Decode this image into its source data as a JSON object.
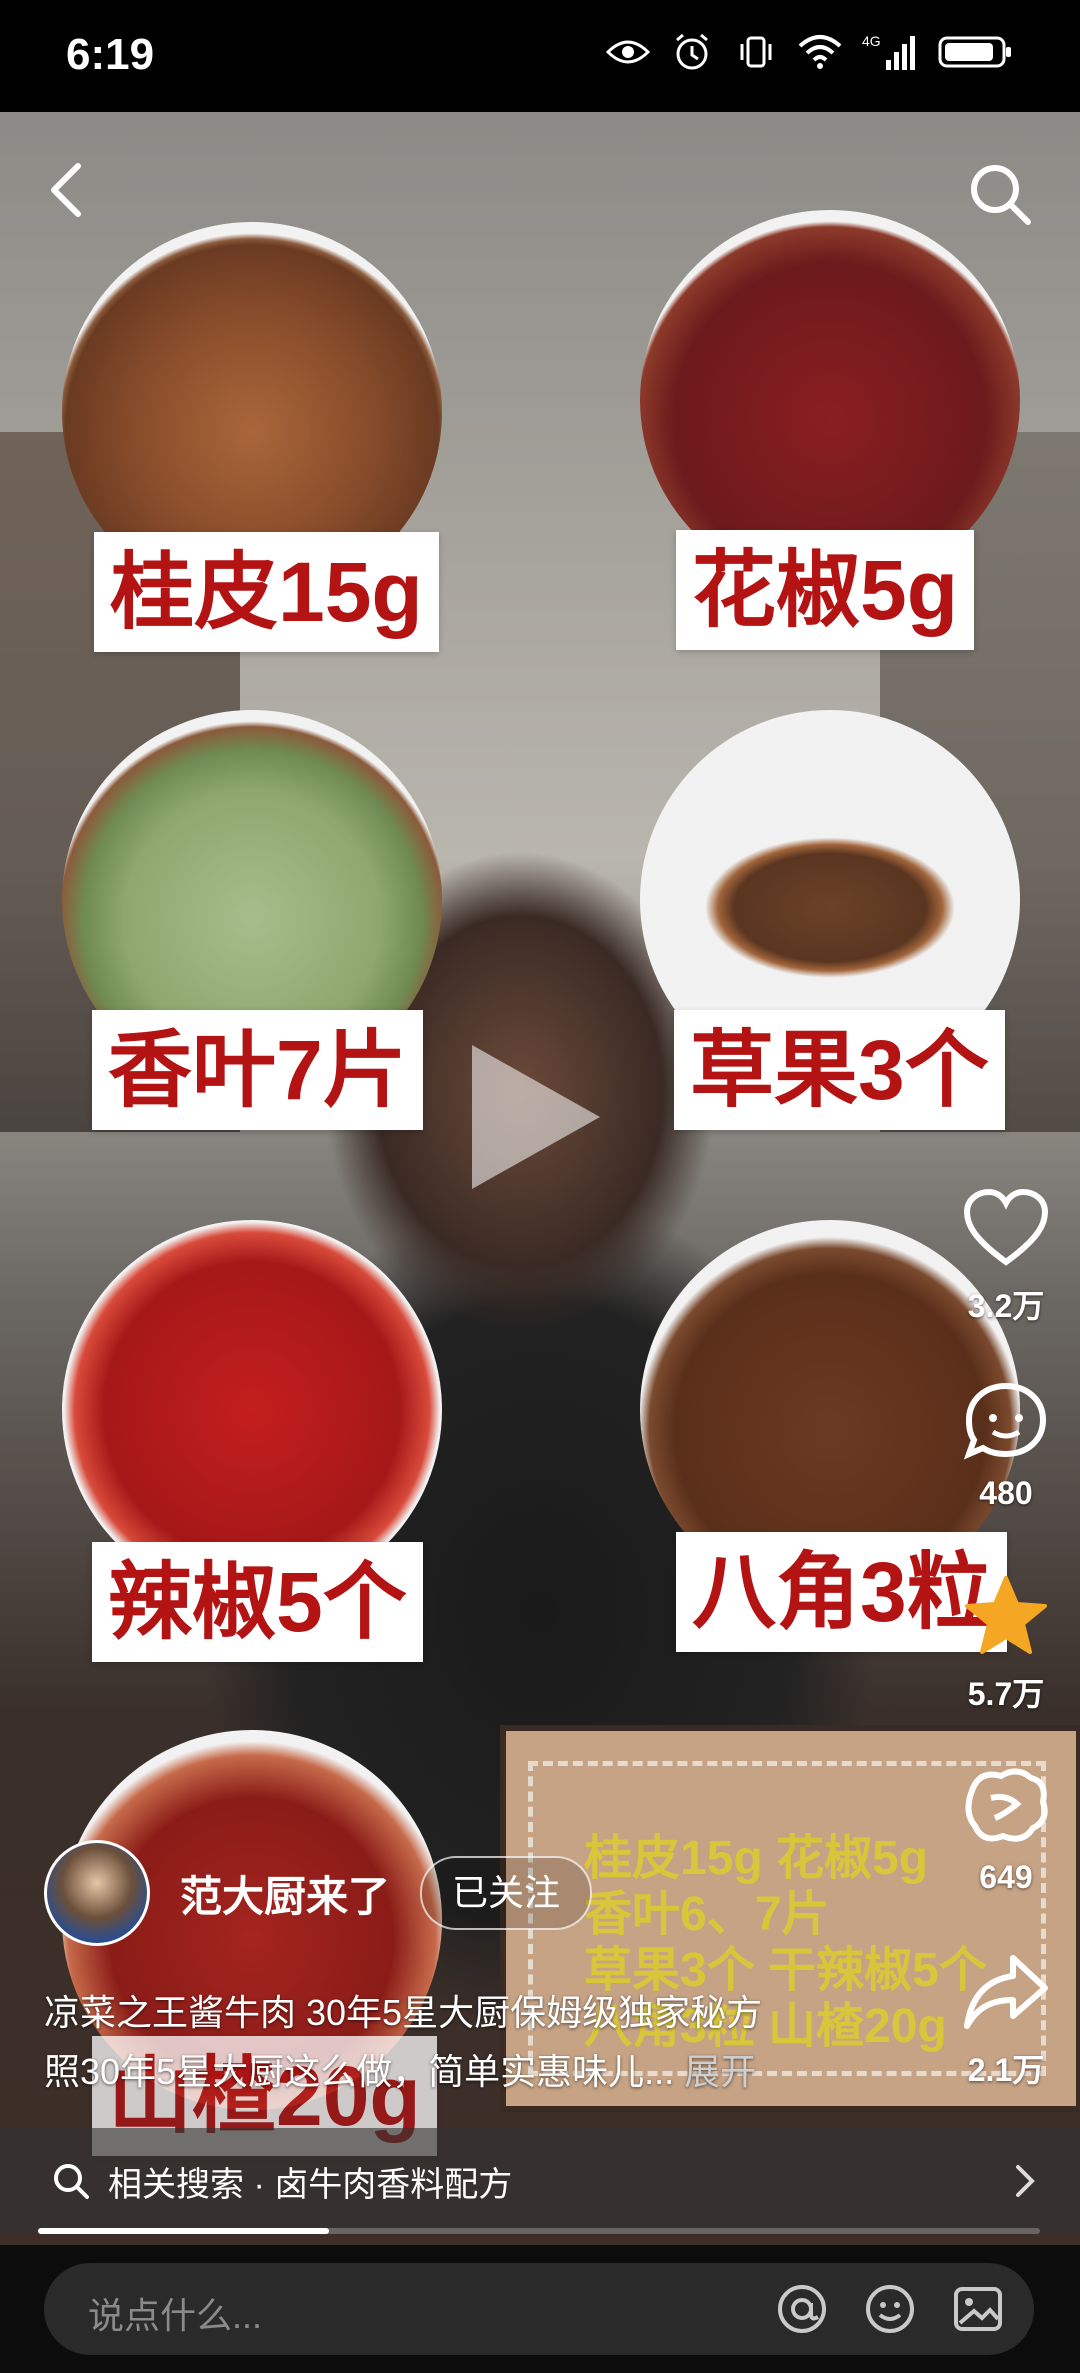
{
  "status_bar": {
    "time": "6:19",
    "network": "4G"
  },
  "spices": [
    {
      "label": "桂皮15g"
    },
    {
      "label": "花椒5g"
    },
    {
      "label": "香叶7片"
    },
    {
      "label": "草果3个"
    },
    {
      "label": "辣椒5个"
    },
    {
      "label": "八角3粒"
    },
    {
      "label": "山楂20g"
    }
  ],
  "actions": {
    "likes": "3.2万",
    "comments": "480",
    "favorites": "5.7万",
    "gifts": "649",
    "shares": "2.1万"
  },
  "note_card": {
    "lines": [
      "桂皮15g 花椒5g",
      "香叶6、7片",
      "草果3个 干辣椒5个",
      "八角3粒 山楂20g"
    ]
  },
  "author": {
    "name": "范大厨来了",
    "follow_label": "已关注"
  },
  "caption": {
    "line1": "凉菜之王酱牛肉 30年5星大厨保姆级独家秘方",
    "line2": "照30年5星大厨这么做，简单实惠味儿...",
    "expand_label": "展开"
  },
  "related": {
    "text": "相关搜索 · 卤牛肉香料配方"
  },
  "progress": {
    "fraction": 0.29
  },
  "comment_bar": {
    "placeholder": "说点什么..."
  },
  "colors": {
    "label_red": "#b31313",
    "favorite_gold": "#f5a623"
  }
}
